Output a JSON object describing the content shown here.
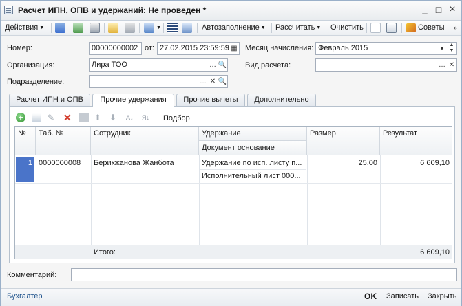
{
  "window": {
    "title": "Расчет ИПН, ОПВ и удержаний: Не проведен *",
    "controls": {
      "minimize": "_",
      "maximize": "□",
      "close": "×"
    }
  },
  "toolbar": {
    "actions_label": "Действия",
    "autofill_label": "Автозаполнение",
    "calculate_label": "Рассчитать",
    "clear_label": "Очистить",
    "advice_label": "Советы"
  },
  "form": {
    "number_label": "Номер:",
    "number_value": "00000000002",
    "from_label": "от:",
    "date_value": "27.02.2015 23:59:59",
    "month_label": "Месяц начисления:",
    "month_value": "Февраль 2015",
    "org_label": "Организация:",
    "org_value": "Лира ТОО",
    "calc_type_label": "Вид расчета:",
    "calc_type_value": "",
    "division_label": "Подразделение:",
    "division_value": ""
  },
  "tabs": [
    {
      "label": "Расчет ИПН и ОПВ"
    },
    {
      "label": "Прочие удержания"
    },
    {
      "label": "Прочие вычеты"
    },
    {
      "label": "Дополнительно"
    }
  ],
  "grid_toolbar": {
    "selection_label": "Подбор"
  },
  "grid": {
    "headers": {
      "num": "№",
      "tab_num": "Таб. №",
      "employee": "Сотрудник",
      "deduction": "Удержание",
      "base_doc": "Документ основание",
      "amount": "Размер",
      "result": "Результат"
    },
    "rows": [
      {
        "num": "1",
        "tab_num": "0000000008",
        "employee": "Берикжанова Жанбота",
        "deduction": "Удержание по исп. листу п...",
        "base_doc": "Исполнительный лист 000...",
        "amount": "25,00",
        "result": "6 609,10"
      }
    ],
    "footer": {
      "total_label": "Итого:",
      "total_value": "6 609,10"
    }
  },
  "comment": {
    "label": "Комментарий:",
    "value": ""
  },
  "bottom": {
    "accountant_link": "Бухгалтер",
    "ok_label": "OK",
    "save_label": "Записать",
    "close_label": "Закрыть"
  },
  "colors": {
    "accent_blue": "#3c6fcf",
    "selected_cell": "#4a74c9",
    "link": "#1a4f8a",
    "delete_red": "#d23a2a",
    "add_green": "#3aa63a"
  }
}
